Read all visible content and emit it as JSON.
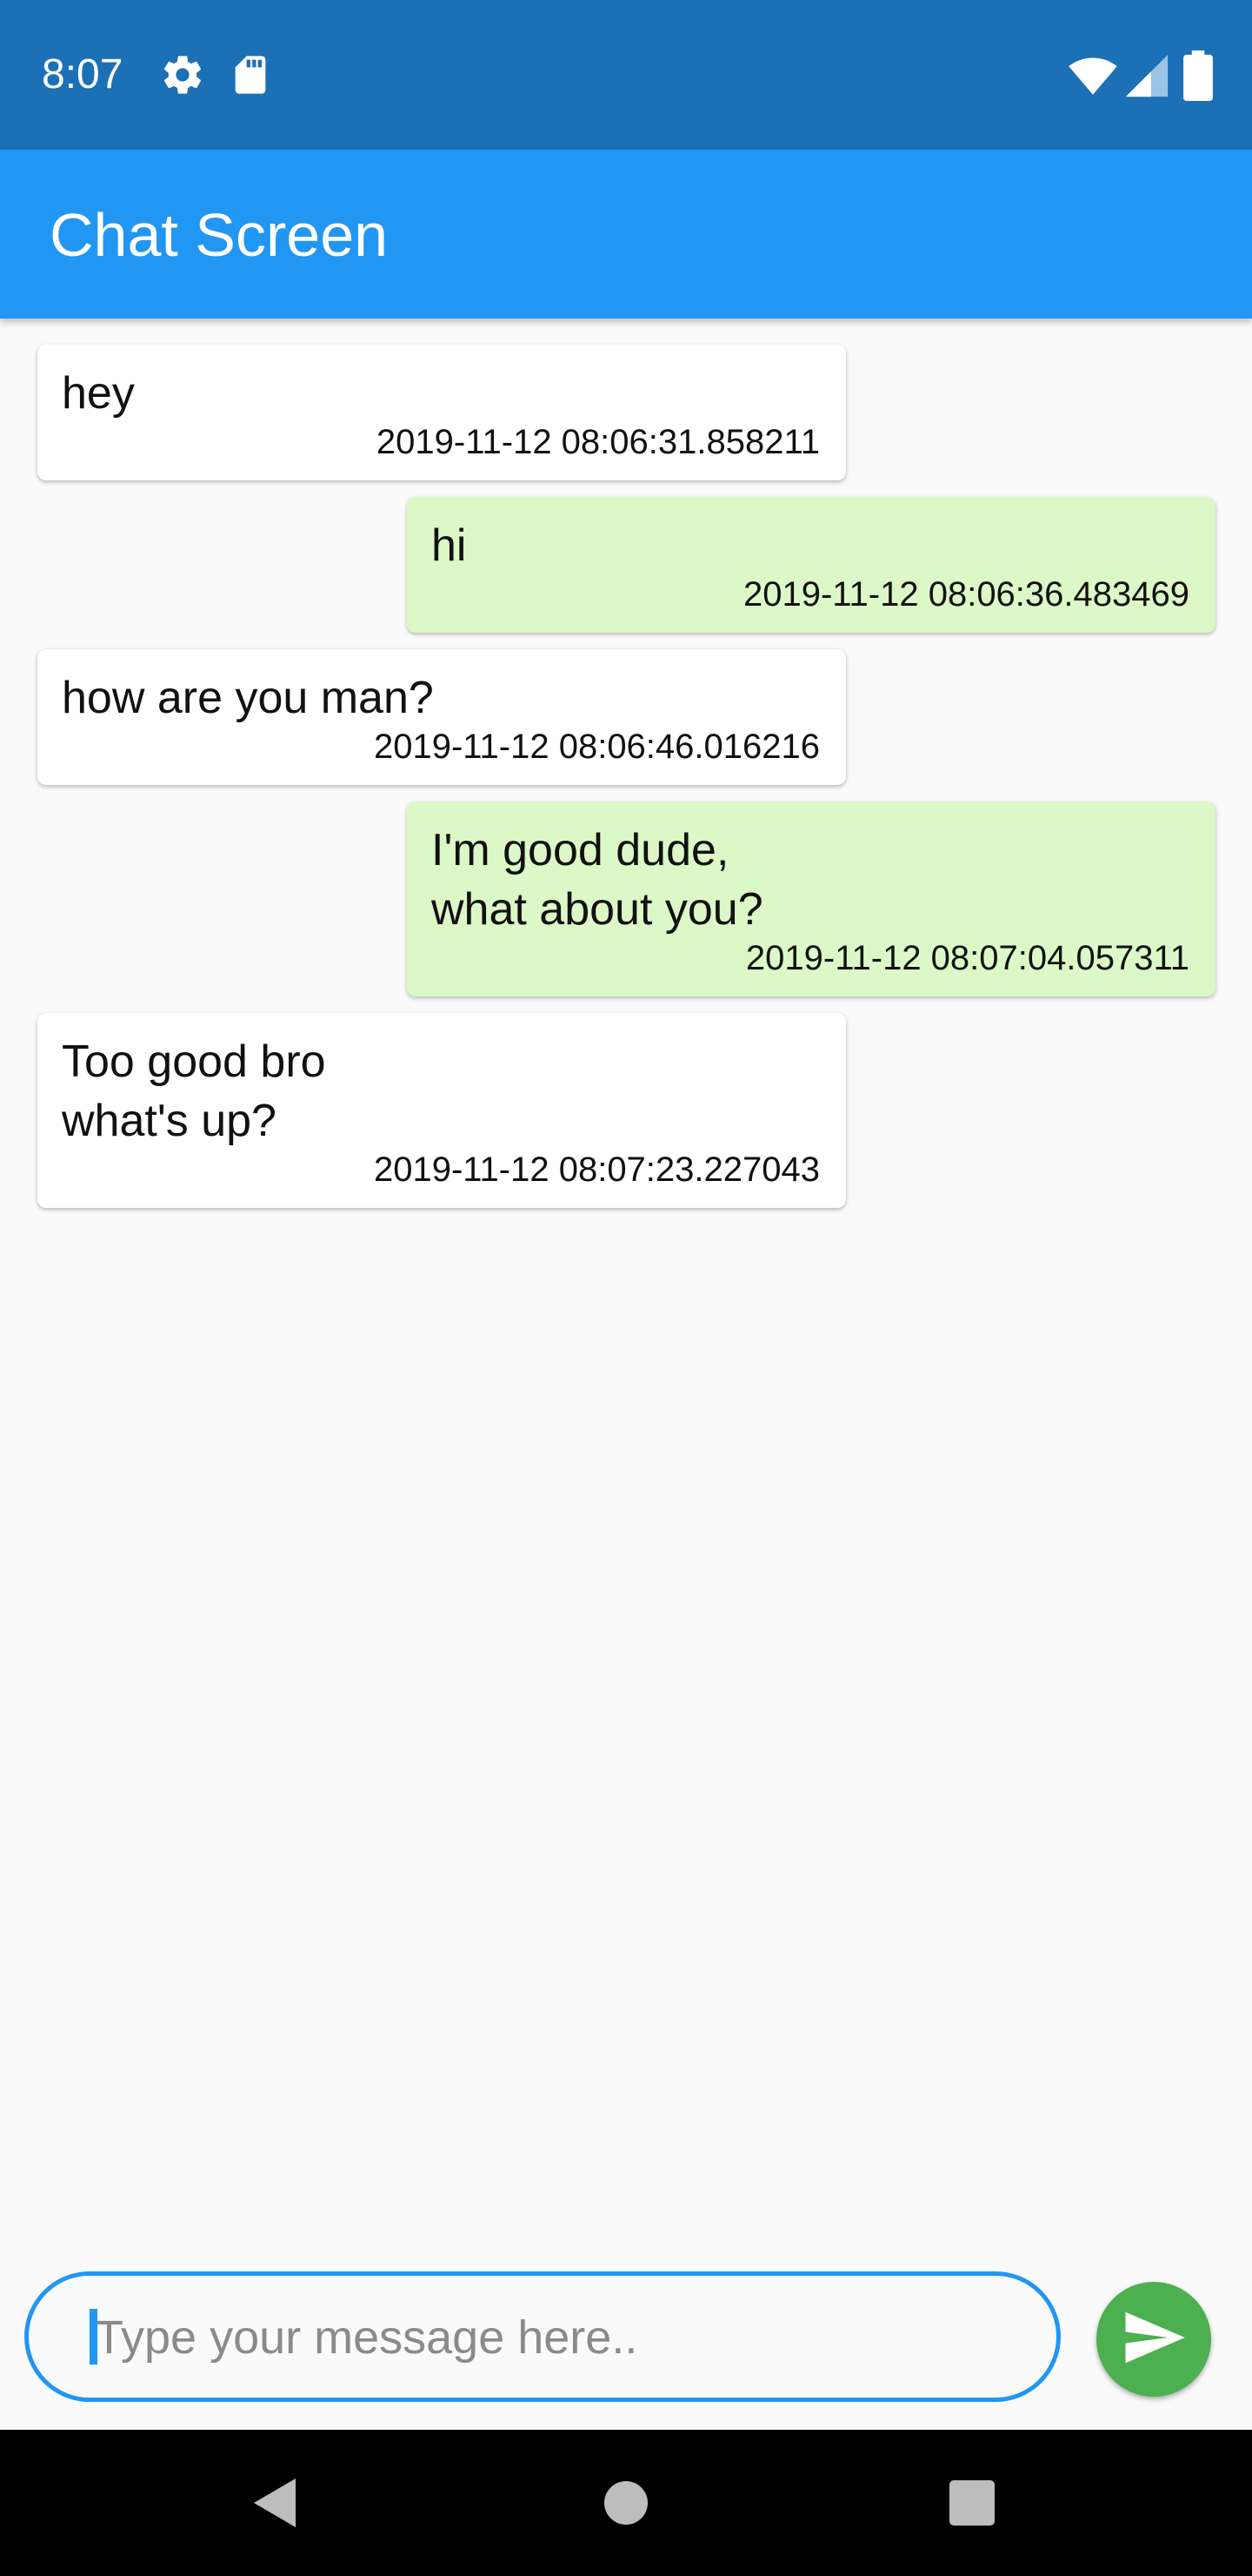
{
  "status_bar": {
    "time": "8:07",
    "icons_left": [
      "gear-icon",
      "sd-card-icon"
    ],
    "icons_right": [
      "wifi-icon",
      "signal-icon",
      "battery-icon"
    ],
    "background": "#1c70b5"
  },
  "app_bar": {
    "title": "Chat Screen",
    "background": "#2196f3"
  },
  "messages": [
    {
      "side": "received",
      "text": "hey",
      "timestamp": "2019-11-12 08:06:31.858211"
    },
    {
      "side": "sent",
      "text": "hi",
      "timestamp": "2019-11-12 08:06:36.483469"
    },
    {
      "side": "received",
      "text": "how are you man?",
      "timestamp": "2019-11-12 08:06:46.016216"
    },
    {
      "side": "sent",
      "text": "I'm good dude,\nwhat about you?",
      "timestamp": "2019-11-12 08:07:04.057311"
    },
    {
      "side": "received",
      "text": "Too good bro\nwhat's up?",
      "timestamp": "2019-11-12 08:07:23.227043"
    }
  ],
  "colors": {
    "received_bubble": "#ffffff",
    "sent_bubble": "#dcf8c6",
    "send_button": "#4caf50",
    "input_border": "#2196f3"
  },
  "composer": {
    "placeholder": "Type your message here..",
    "value": "",
    "send_icon": "send-icon"
  },
  "nav_bar": {
    "buttons": [
      "back-icon",
      "home-icon",
      "recents-icon"
    ]
  }
}
